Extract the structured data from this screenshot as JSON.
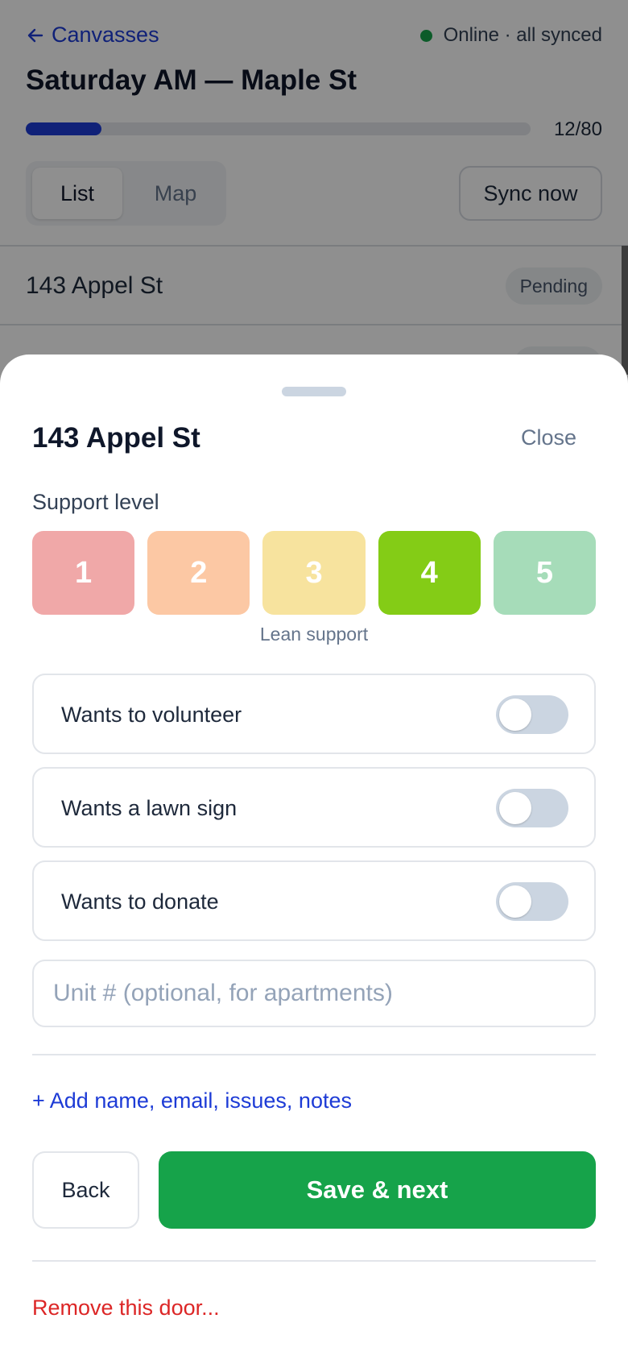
{
  "header": {
    "back_label": "Canvasses",
    "status_text": "Online · all synced",
    "title": "Saturday AM — Maple St",
    "progress": {
      "done": 12,
      "total": 80,
      "label": "12/80"
    },
    "view_tabs": [
      {
        "label": "List",
        "active": true
      },
      {
        "label": "Map",
        "active": false
      }
    ],
    "sync_label": "Sync now"
  },
  "doors": [
    {
      "address": "143 Appel St",
      "status": "Pending"
    },
    {
      "address": "",
      "status": ""
    }
  ],
  "sheet": {
    "title": "143 Appel St",
    "close_label": "Close",
    "support_label": "Support level",
    "ratings": [
      {
        "label": "1",
        "color": "#f0a8a8"
      },
      {
        "label": "2",
        "color": "#fcc8a4"
      },
      {
        "label": "3",
        "color": "#f7e39e"
      },
      {
        "label": "4",
        "color": "#84cc16"
      },
      {
        "label": "5",
        "color": "#a6dcb9"
      }
    ],
    "selected_rating": 4,
    "rating_caption": "Lean support",
    "toggles": [
      {
        "label": "Wants to volunteer",
        "on": false
      },
      {
        "label": "Wants a lawn sign",
        "on": false
      },
      {
        "label": "Wants to donate",
        "on": false
      }
    ],
    "unit_placeholder": "Unit # (optional, for apartments)",
    "add_link": "+ Add name, email, issues, notes",
    "back_label": "Back",
    "save_label": "Save & next",
    "remove_label": "Remove this door..."
  },
  "colors": {
    "accent": "#1d3bd6",
    "success": "#16a34a",
    "danger": "#dc2626"
  }
}
